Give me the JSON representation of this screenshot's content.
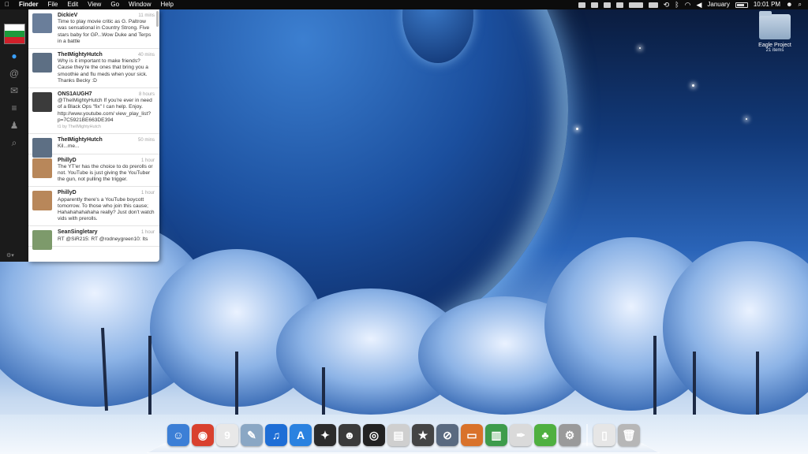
{
  "menubar": {
    "apple": "",
    "items": [
      "Finder",
      "File",
      "Edit",
      "View",
      "Go",
      "Window",
      "Help"
    ],
    "clock_date": "January",
    "clock_time": "10:01 PM"
  },
  "twitter": {
    "tweets": [
      {
        "name": "DickieV",
        "time": "11 mins",
        "text": "Time to play movie critic as G. Paltrow was sensational in Country Strong. Five stars baby for GP...Wow Duke and Terps in a battle",
        "via": "",
        "avatar": "#6a7e9a"
      },
      {
        "name": "TheIMightyHutch",
        "time": "40 mins",
        "text": "Why is it important to make friends? Cause they're the ones that bring you a smoothie and flu meds when your sick. Thanks Becky :D",
        "via": "",
        "avatar": "#5d6f84"
      },
      {
        "name": "ONS1AUGH7",
        "time": "8 hours",
        "text": "@TheIMightyHutch If you're ever in need of a Black Ops \"fix\" I can help. Enjoy.  http://www.youtube.com/ view_play_list?p=7C5921BE663DE394",
        "via": "t1 by TheIMightyHutch",
        "avatar": "#3b3b3b"
      },
      {
        "name": "TheIMightyHutch",
        "time": "50 mins",
        "text": "Kil...me...",
        "via": "",
        "avatar": "#5d6f84"
      },
      {
        "name": "PhillyD",
        "time": "1 hour",
        "text": "The YT'er has the choice to do prerolls or not. YouTube is just giving the YouTuber the gun, not pulling the trigger.",
        "via": "",
        "avatar": "#b8875a"
      },
      {
        "name": "PhillyD",
        "time": "1 hour",
        "text": "Apparently there's a YouTube boycott tomorrow. To those who join this cause; Hahahahahahaha really?  Just don't watch vids with prerolls.",
        "via": "",
        "avatar": "#b8875a"
      },
      {
        "name": "SeanSingletary",
        "time": "1 hour",
        "text": "RT @SiR215: RT @rodneygreen10: Its",
        "via": "",
        "avatar": "#7d9a6b"
      }
    ]
  },
  "desktop": {
    "folder_name": "Eagle Project",
    "folder_sub": "21 items"
  },
  "dock": {
    "items": [
      {
        "name": "finder-icon",
        "glyph": "☺",
        "color": "#3c7fd6"
      },
      {
        "name": "chrome-icon",
        "glyph": "◉",
        "color": "#d9412e"
      },
      {
        "name": "ical-icon",
        "glyph": "9",
        "color": "#e8e8e8"
      },
      {
        "name": "preview-icon",
        "glyph": "✎",
        "color": "#8aa7c4"
      },
      {
        "name": "itunes-icon",
        "glyph": "♫",
        "color": "#1e6ed6"
      },
      {
        "name": "app-store-icon",
        "glyph": "A",
        "color": "#2a82e0"
      },
      {
        "name": "twitter-icon",
        "glyph": "✦",
        "color": "#2b2b2b"
      },
      {
        "name": "ninja-icon",
        "glyph": "☻",
        "color": "#3a3a3a"
      },
      {
        "name": "aperture-icon",
        "glyph": "◎",
        "color": "#222"
      },
      {
        "name": "clapper-icon",
        "glyph": "▤",
        "color": "#cfcfcf"
      },
      {
        "name": "imovie-icon",
        "glyph": "★",
        "color": "#444"
      },
      {
        "name": "safari-icon",
        "glyph": "⊘",
        "color": "#5a6a80"
      },
      {
        "name": "keynote-icon",
        "glyph": "▭",
        "color": "#d9722a"
      },
      {
        "name": "numbers-icon",
        "glyph": "▥",
        "color": "#3e9c4c"
      },
      {
        "name": "textedit-icon",
        "glyph": "✒",
        "color": "#dadada"
      },
      {
        "name": "adium-icon",
        "glyph": "♣",
        "color": "#4fb040"
      },
      {
        "name": "system-prefs-icon",
        "glyph": "⚙",
        "color": "#9a9a9a"
      }
    ],
    "right_items": [
      {
        "name": "documents-icon",
        "glyph": "▯",
        "color": "#e6e6e6"
      },
      {
        "name": "trash-icon",
        "glyph": "🗑",
        "color": "#b7b7b7"
      }
    ]
  }
}
